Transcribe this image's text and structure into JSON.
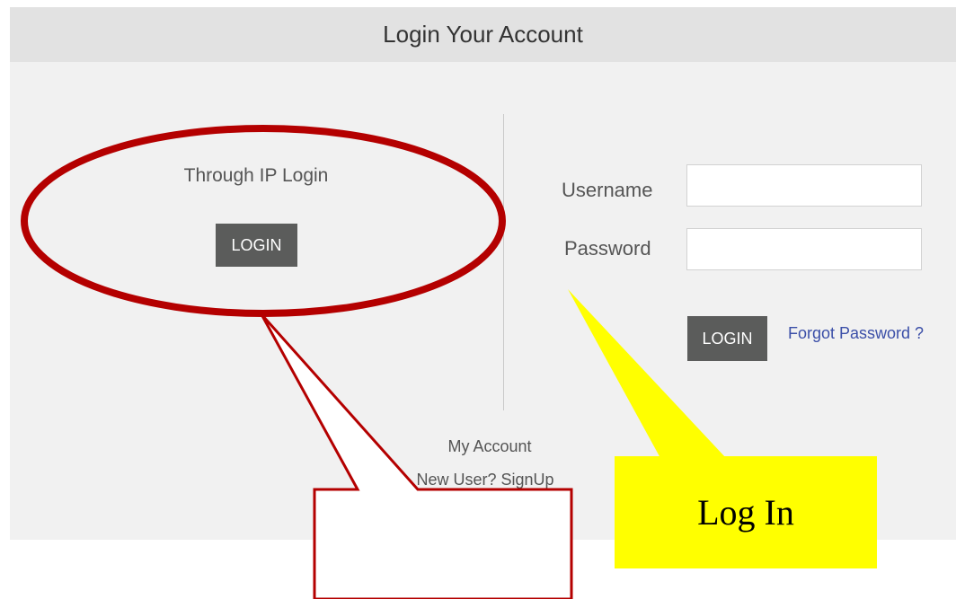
{
  "panel": {
    "title": "Login Your Account"
  },
  "ip_login": {
    "label": "Through IP Login",
    "button_label": "LOGIN"
  },
  "credentials": {
    "username_label": "Username",
    "username_value": "",
    "password_label": "Password",
    "password_value": "",
    "login_button_label": "LOGIN",
    "forgot_link": "Forgot Password ?"
  },
  "links": {
    "my_account": "My Account",
    "signup": "New User? SignUp"
  },
  "annotations": {
    "callout_text": "Log In",
    "callout_color": "#ffff00",
    "circle_color": "#b40000"
  }
}
